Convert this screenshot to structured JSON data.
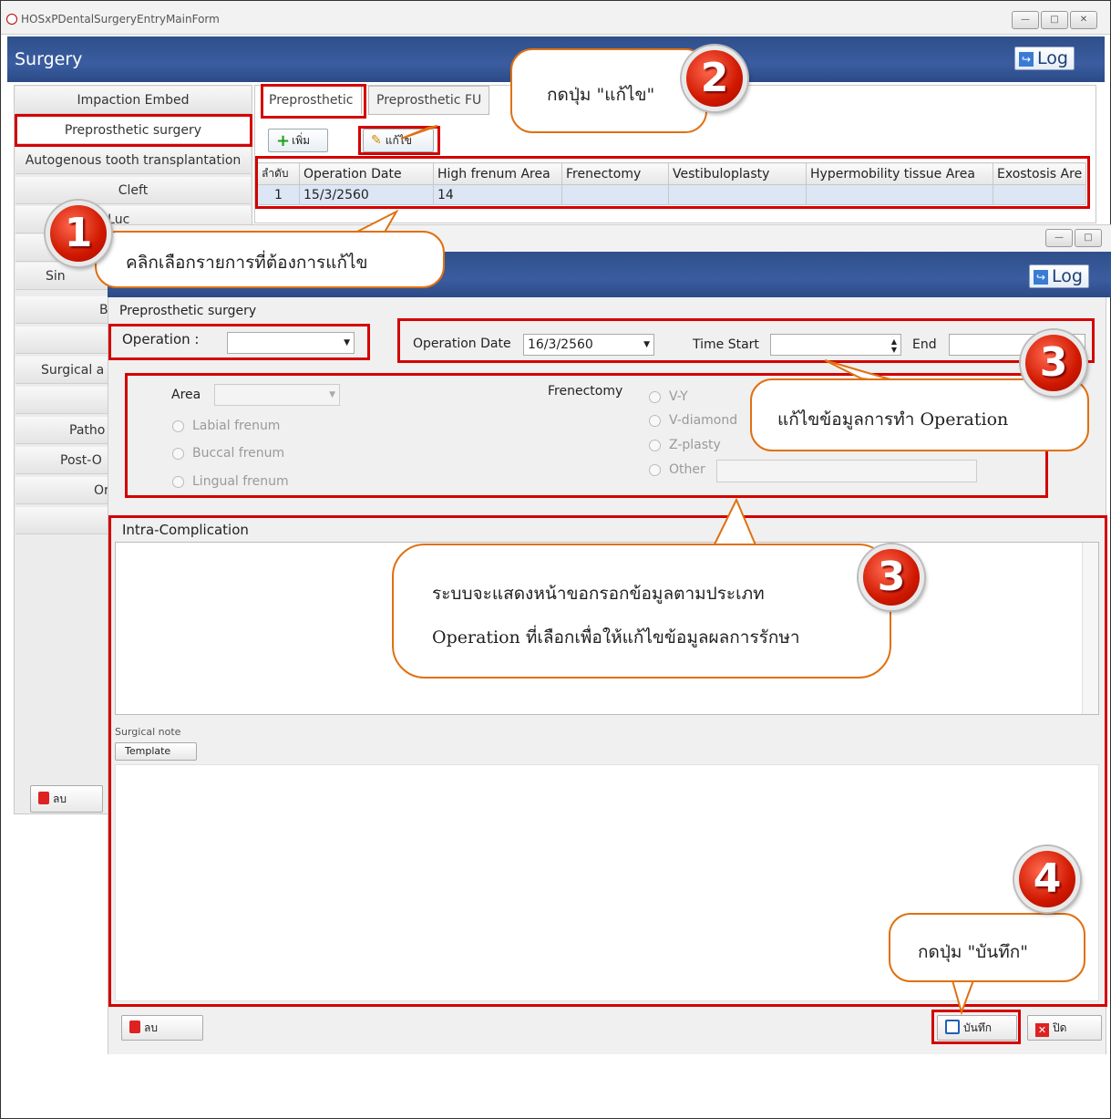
{
  "back_window": {
    "title": "HOSxPDentalSurgeryEntryMainForm",
    "header": "Surgery",
    "log_label": "Log",
    "left_menu": [
      "Impaction Embed",
      "Preprosthetic surgery",
      "Autogenous tooth transplantation",
      "Cleft",
      "dwell Luc",
      "",
      "Sin",
      "B",
      "",
      "Surgical a",
      "",
      "Patho",
      "Post-O",
      "Or",
      ""
    ],
    "delete_label": "ลบ",
    "tabs": [
      "Preprosthetic",
      "Preprosthetic FU"
    ],
    "toolbar": {
      "add_label": "เพิ่ม",
      "edit_label": "แก้ไข"
    },
    "grid": {
      "columns": [
        "ลำดับ",
        "Operation Date",
        "High frenum Area",
        "Frenectomy",
        "Vestibuloplasty",
        "Hypermobility tissue Area",
        "Exostosis Are"
      ],
      "rows": [
        [
          "1",
          "15/3/2560",
          "14",
          "",
          "",
          "",
          ""
        ]
      ]
    }
  },
  "front_window": {
    "log_label": "Log",
    "section_title": "Preprosthetic surgery",
    "operation_label": "Operation :",
    "operation_value": "",
    "operation_date_label": "Operation Date",
    "operation_date_value": "16/3/2560",
    "time_start_label": "Time Start",
    "time_start_value": "",
    "end_label": "End",
    "end_value": "",
    "area_label": "Area",
    "area_value": "",
    "frenum_options": [
      "Labial frenum",
      "Buccal frenum",
      "Lingual frenum"
    ],
    "frenectomy_label": "Frenectomy",
    "frenectomy_options": [
      "V-Y",
      "V-diamond",
      "Z-plasty",
      "Other"
    ],
    "intra_complication_label": "Intra-Complication",
    "surgical_note_label": "Surgical note",
    "template_label": "Template",
    "delete_label": "ลบ",
    "save_label": "บันทึก",
    "close_label": "ปิด"
  },
  "callouts": {
    "step1_text": "คลิกเลือกรายการที่ต้องการแก้ไข",
    "step2_text": "กดปุ่ม \"แก้ไข\"",
    "step3a_text": "แก้ไขข้อมูลการทำ Operation",
    "step3b_line1": "ระบบจะแสดงหน้าขอกรอกข้อมูลตามประเภท",
    "step3b_line2": "Operation ที่เลือกเพื่อให้แก้ไขข้อมูลผลการรักษา",
    "step4_text": "กดปุ่ม \"บันทึก\"",
    "badges": [
      "1",
      "2",
      "3",
      "3",
      "4"
    ]
  },
  "colors": {
    "highlight": "#d40000",
    "callout_border": "#e07010",
    "header_blue": "#3b5da0"
  }
}
